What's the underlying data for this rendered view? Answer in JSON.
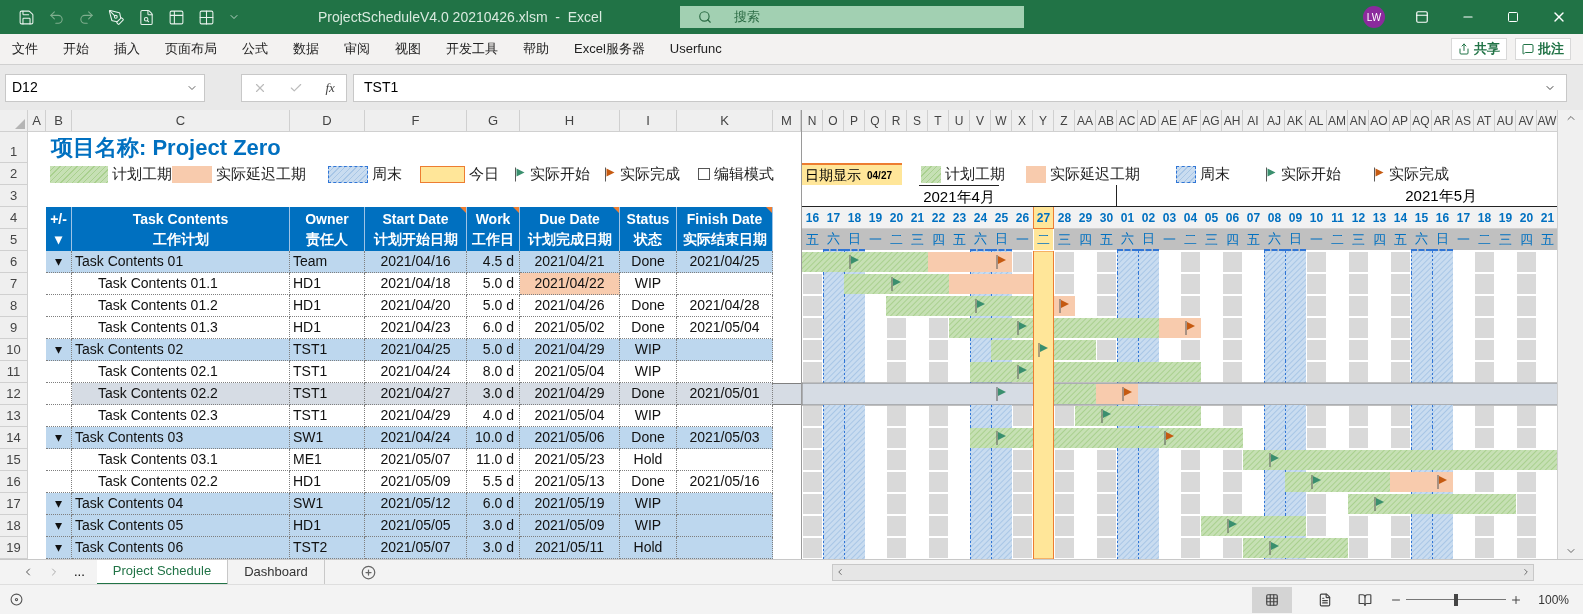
{
  "title_bar": {
    "title": "ProjectScheduleV4.0 20210426.xlsm  -  Excel",
    "search_placeholder": "搜索",
    "avatar": "LW"
  },
  "quick_access": [
    {
      "kind": "save",
      "disabled": false
    },
    {
      "kind": "undo",
      "disabled": true
    },
    {
      "kind": "redo",
      "disabled": true
    },
    {
      "kind": "draw",
      "disabled": false
    },
    {
      "kind": "preview",
      "disabled": false
    },
    {
      "kind": "form",
      "disabled": false
    },
    {
      "kind": "borders",
      "disabled": false
    },
    {
      "kind": "customize",
      "disabled": false
    }
  ],
  "menu": [
    "文件",
    "开始",
    "插入",
    "页面布局",
    "公式",
    "数据",
    "审阅",
    "视图",
    "开发工具",
    "帮助",
    "Excel服务器",
    "Userfunc"
  ],
  "share": "共享",
  "comments": "批注",
  "formula_bar": {
    "name_box": "D12",
    "fx": "fx",
    "value": "TST1"
  },
  "columns": [
    "A",
    "B",
    "C",
    "D",
    "F",
    "G",
    "H",
    "I",
    "K",
    "M"
  ],
  "header_row_numbers": [
    "1",
    "2",
    "3",
    "4",
    "5"
  ],
  "sheet_title": "项目名称: Project Zero",
  "legend": [
    {
      "kind": "plan",
      "label": "计划工期"
    },
    {
      "kind": "delay",
      "label": "实际延迟工期"
    },
    {
      "kind": "weekend",
      "label": "周末"
    },
    {
      "kind": "today",
      "label": "今日"
    },
    {
      "kind": "start",
      "label": "实际开始"
    },
    {
      "kind": "finish",
      "label": "实际完成"
    },
    {
      "kind": "checkbox",
      "label": "编辑模式",
      "checked": false
    }
  ],
  "table_header": [
    {
      "title": "+/-",
      "subtitle": "▾",
      "comment": false
    },
    {
      "title": "Task Contents",
      "subtitle": "工作计划",
      "comment": false
    },
    {
      "title": "Owner",
      "subtitle": "责任人",
      "comment": false
    },
    {
      "title": "Start Date",
      "subtitle": "计划开始日期",
      "comment": true
    },
    {
      "title": "Work",
      "subtitle": "工作日",
      "comment": true
    },
    {
      "title": "Due Date",
      "subtitle": "计划完成日期",
      "comment": true
    },
    {
      "title": "Status",
      "subtitle": "状态",
      "comment": false
    },
    {
      "title": "Finish Date",
      "subtitle": "实际结束日期",
      "comment": true
    }
  ],
  "rows": [
    {
      "row_number": "6",
      "kind": "group",
      "toggle": "▾",
      "task": "Task Contents 01",
      "owner": "Team",
      "start": "2021/04/16",
      "work": "4.5 d",
      "due": "2021/04/21",
      "overdue": false,
      "status": "Done",
      "finish": "2021/04/25",
      "selected": false
    },
    {
      "row_number": "7",
      "kind": "task",
      "task": "Task Contents 01.1",
      "owner": "HD1",
      "start": "2021/04/18",
      "work": "5.0 d",
      "due": "2021/04/22",
      "overdue": true,
      "status": "WIP",
      "selected": false
    },
    {
      "row_number": "8",
      "kind": "task",
      "task": "Task Contents 01.2",
      "owner": "HD1",
      "start": "2021/04/20",
      "work": "5.0 d",
      "due": "2021/04/26",
      "overdue": false,
      "status": "Done",
      "finish": "2021/04/28",
      "selected": false
    },
    {
      "row_number": "9",
      "kind": "task",
      "task": "Task Contents 01.3",
      "owner": "HD1",
      "start": "2021/04/23",
      "work": "6.0 d",
      "due": "2021/05/02",
      "overdue": false,
      "status": "Done",
      "finish": "2021/05/04",
      "selected": false
    },
    {
      "row_number": "10",
      "kind": "group",
      "toggle": "▾",
      "task": "Task Contents 02",
      "owner": "TST1",
      "start": "2021/04/25",
      "work": "5.0 d",
      "due": "2021/04/29",
      "overdue": false,
      "status": "WIP",
      "selected": false
    },
    {
      "row_number": "11",
      "kind": "task",
      "task": "Task Contents 02.1",
      "owner": "TST1",
      "start": "2021/04/24",
      "work": "8.0 d",
      "due": "2021/05/04",
      "overdue": false,
      "status": "WIP",
      "selected": false
    },
    {
      "row_number": "12",
      "kind": "task",
      "task": "Task Contents 02.2",
      "owner": "TST1",
      "start": "2021/04/27",
      "work": "3.0 d",
      "due": "2021/04/29",
      "overdue": false,
      "status": "Done",
      "finish": "2021/05/01",
      "selected": true
    },
    {
      "row_number": "13",
      "kind": "task",
      "task": "Task Contents 02.3",
      "owner": "TST1",
      "start": "2021/04/29",
      "work": "4.0 d",
      "due": "2021/05/04",
      "overdue": false,
      "status": "WIP",
      "selected": false
    },
    {
      "row_number": "14",
      "kind": "group",
      "toggle": "▾",
      "task": "Task Contents 03",
      "owner": "SW1",
      "start": "2021/04/24",
      "work": "10.0 d",
      "due": "2021/05/06",
      "overdue": false,
      "status": "Done",
      "finish": "2021/05/03",
      "selected": false
    },
    {
      "row_number": "15",
      "kind": "task",
      "task": "Task Contents 03.1",
      "owner": "ME1",
      "start": "2021/05/07",
      "work": "11.0 d",
      "due": "2021/05/23",
      "overdue": false,
      "status": "Hold",
      "selected": false
    },
    {
      "row_number": "16",
      "kind": "task",
      "task": "Task Contents 02.2",
      "owner": "HD1",
      "start": "2021/05/09",
      "work": "5.5 d",
      "due": "2021/05/13",
      "overdue": false,
      "status": "Done",
      "finish": "2021/05/16",
      "selected": false
    },
    {
      "row_number": "17",
      "kind": "group",
      "toggle": "▾",
      "task": "Task Contents 04",
      "owner": "SW1",
      "start": "2021/05/12",
      "work": "6.0 d",
      "due": "2021/05/19",
      "overdue": false,
      "status": "WIP",
      "selected": false
    },
    {
      "row_number": "18",
      "kind": "group",
      "toggle": "▾",
      "task": "Task Contents 05",
      "owner": "HD1",
      "start": "2021/05/05",
      "work": "3.0 d",
      "due": "2021/05/09",
      "overdue": false,
      "status": "WIP",
      "selected": false
    },
    {
      "row_number": "19",
      "kind": "group",
      "toggle": "▾",
      "task": "Task Contents 06",
      "owner": "TST2",
      "start": "2021/05/07",
      "work": "3.0 d",
      "due": "2021/05/11",
      "overdue": false,
      "status": "Hold",
      "selected": false
    }
  ],
  "gantt": {
    "date_display": {
      "label": "日期显示",
      "value": "04/27"
    },
    "legend": [
      {
        "kind": "plan",
        "label": "计划工期"
      },
      {
        "kind": "delay",
        "label": "实际延迟工期"
      },
      {
        "kind": "weekend",
        "label": "周末"
      },
      {
        "kind": "start",
        "label": "实际开始"
      },
      {
        "kind": "finish",
        "label": "实际完成"
      }
    ],
    "months": [
      "2021年4月",
      "2021年5月"
    ],
    "days": [
      {
        "column": "N",
        "day": "16",
        "weekday": "五",
        "weekend": false,
        "today": false
      },
      {
        "column": "O",
        "day": "17",
        "weekday": "六",
        "weekend": true,
        "today": false
      },
      {
        "column": "P",
        "day": "18",
        "weekday": "日",
        "weekend": true,
        "today": false
      },
      {
        "column": "Q",
        "day": "19",
        "weekday": "一",
        "weekend": false,
        "today": false
      },
      {
        "column": "R",
        "day": "20",
        "weekday": "二",
        "weekend": false,
        "today": false
      },
      {
        "column": "S",
        "day": "21",
        "weekday": "三",
        "weekend": false,
        "today": false
      },
      {
        "column": "T",
        "day": "22",
        "weekday": "四",
        "weekend": false,
        "today": false
      },
      {
        "column": "U",
        "day": "23",
        "weekday": "五",
        "weekend": false,
        "today": false
      },
      {
        "column": "V",
        "day": "24",
        "weekday": "六",
        "weekend": true,
        "today": false
      },
      {
        "column": "W",
        "day": "25",
        "weekday": "日",
        "weekend": true,
        "today": false
      },
      {
        "column": "X",
        "day": "26",
        "weekday": "一",
        "weekend": false,
        "today": false
      },
      {
        "column": "Y",
        "day": "27",
        "weekday": "二",
        "weekend": false,
        "today": true
      },
      {
        "column": "Z",
        "day": "28",
        "weekday": "三",
        "weekend": false,
        "today": false
      },
      {
        "column": "AA",
        "day": "29",
        "weekday": "四",
        "weekend": false,
        "today": false
      },
      {
        "column": "AB",
        "day": "30",
        "weekday": "五",
        "weekend": false,
        "today": false
      },
      {
        "column": "AC",
        "day": "01",
        "weekday": "六",
        "weekend": true,
        "today": false
      },
      {
        "column": "AD",
        "day": "02",
        "weekday": "日",
        "weekend": true,
        "today": false
      },
      {
        "column": "AE",
        "day": "03",
        "weekday": "一",
        "weekend": false,
        "today": false
      },
      {
        "column": "AF",
        "day": "04",
        "weekday": "二",
        "weekend": false,
        "today": false
      },
      {
        "column": "AG",
        "day": "05",
        "weekday": "三",
        "weekend": false,
        "today": false
      },
      {
        "column": "AH",
        "day": "06",
        "weekday": "四",
        "weekend": false,
        "today": false
      },
      {
        "column": "AI",
        "day": "07",
        "weekday": "五",
        "weekend": false,
        "today": false
      },
      {
        "column": "AJ",
        "day": "08",
        "weekday": "六",
        "weekend": true,
        "today": false
      },
      {
        "column": "AK",
        "day": "09",
        "weekday": "日",
        "weekend": true,
        "today": false
      },
      {
        "column": "AL",
        "day": "10",
        "weekday": "一",
        "weekend": false,
        "today": false
      },
      {
        "column": "AM",
        "day": "11",
        "weekday": "二",
        "weekend": false,
        "today": false
      },
      {
        "column": "AN",
        "day": "12",
        "weekday": "三",
        "weekend": false,
        "today": false
      },
      {
        "column": "AO",
        "day": "13",
        "weekday": "四",
        "weekend": false,
        "today": false
      },
      {
        "column": "AP",
        "day": "14",
        "weekday": "五",
        "weekend": false,
        "today": false
      },
      {
        "column": "AQ",
        "day": "15",
        "weekday": "六",
        "weekend": true,
        "today": false
      },
      {
        "column": "AR",
        "day": "16",
        "weekday": "日",
        "weekend": true,
        "today": false
      },
      {
        "column": "AS",
        "day": "17",
        "weekday": "一",
        "weekend": false,
        "today": false
      },
      {
        "column": "AT",
        "day": "18",
        "weekday": "二",
        "weekend": false,
        "today": false
      },
      {
        "column": "AU",
        "day": "19",
        "weekday": "三",
        "weekend": false,
        "today": false
      },
      {
        "column": "AV",
        "day": "20",
        "weekday": "四",
        "weekend": false,
        "today": false
      },
      {
        "column": "AW",
        "day": "21",
        "weekday": "五",
        "weekend": false,
        "today": false
      }
    ]
  },
  "sheet_tabs": {
    "more": "...",
    "tabs": [
      {
        "label": "Project Schedule",
        "selected": true
      },
      {
        "label": "Dashboard",
        "selected": false
      }
    ]
  },
  "status_bar": {
    "zoom": "100%",
    "zoom_slider": {
      "level": 0.5
    }
  }
}
